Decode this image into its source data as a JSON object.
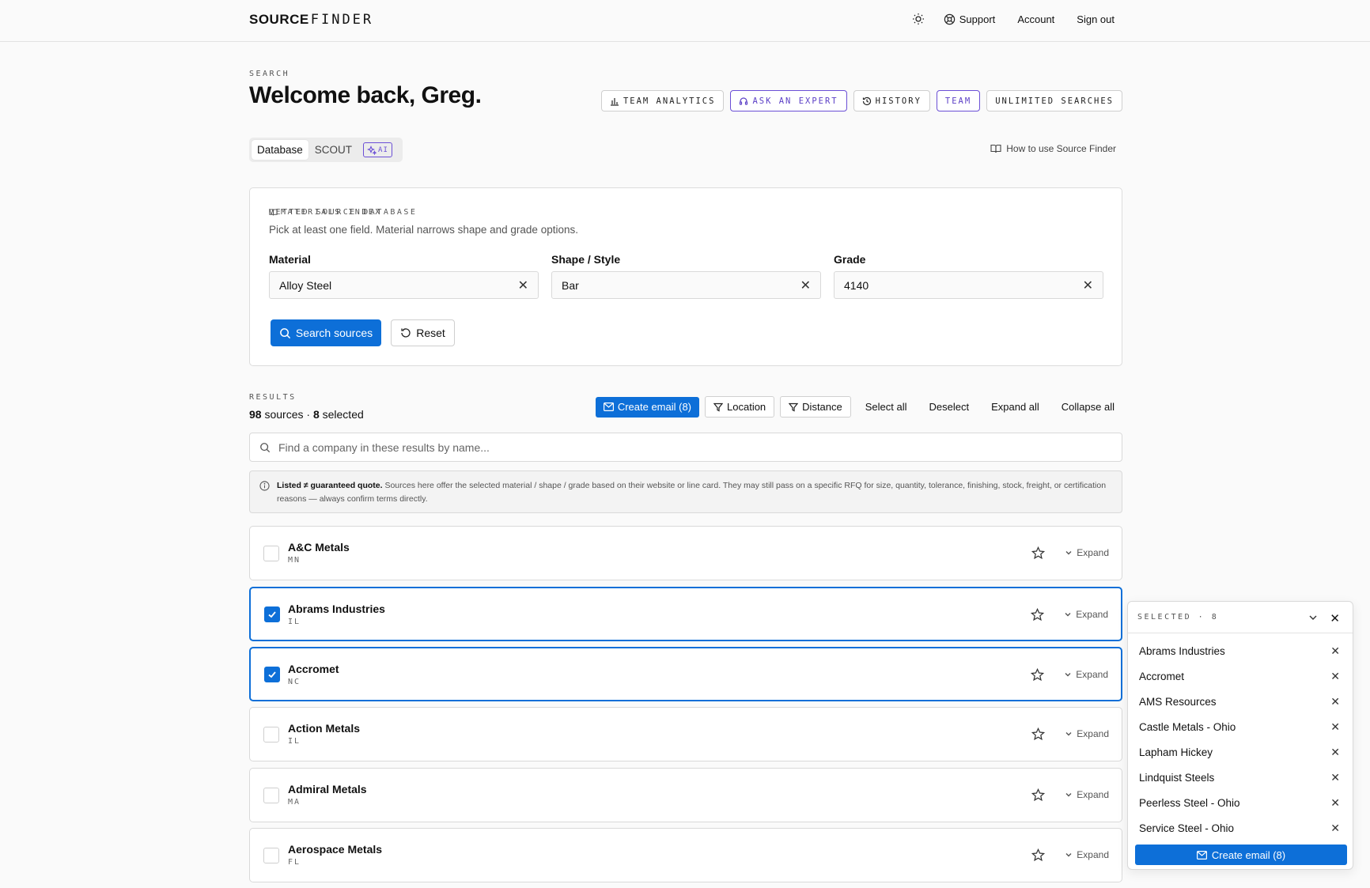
{
  "brand": {
    "part1": "SOURCE",
    "part2": "FINDER"
  },
  "topnav": {
    "support": "Support",
    "account": "Account",
    "signout": "Sign out"
  },
  "hero": {
    "eyebrow": "SEARCH",
    "welcome": "Welcome back, Greg."
  },
  "pills": {
    "team_analytics": "TEAM ANALYTICS",
    "ask_expert": "ASK AN EXPERT",
    "history": "HISTORY",
    "team": "TEAM",
    "unlimited": "UNLIMITED SEARCHES"
  },
  "modes": {
    "database": "Database",
    "scout": "SCOUT",
    "ai": "AI"
  },
  "howto": "How to use Source Finder",
  "search_card": {
    "eyebrow": "VETTED SOURCE DATABASE",
    "materials_index": "MATERIALS INDEX",
    "hint": "Pick at least one field. Material narrows shape and grade options.",
    "fields": {
      "material": {
        "label": "Material",
        "value": "Alloy Steel"
      },
      "shape": {
        "label": "Shape / Style",
        "value": "Bar"
      },
      "grade": {
        "label": "Grade",
        "value": "4140"
      }
    },
    "search_button": "Search sources",
    "reset_button": "Reset"
  },
  "results": {
    "eyebrow": "RESULTS",
    "count": "98",
    "count_suffix": "sources ·",
    "selected": "8",
    "selected_suffix": "selected",
    "create_email": "Create email (8)",
    "location": "Location",
    "distance": "Distance",
    "select_all": "Select all",
    "deselect": "Deselect",
    "expand_all": "Expand all",
    "collapse_all": "Collapse all",
    "search_placeholder": "Find a company in these results by name...",
    "notice_bold": "Listed ≠ guaranteed quote.",
    "notice_text": " Sources here offer the selected material / shape / grade based on their website or line card. They may still pass on a specific RFQ for size, quantity, tolerance, finishing, stock, freight, or certification reasons — always confirm terms directly.",
    "expand_label": "Expand",
    "rows": [
      {
        "name": "A&C Metals",
        "state": "MN",
        "selected": false
      },
      {
        "name": "Abrams Industries",
        "state": "IL",
        "selected": true
      },
      {
        "name": "Accromet",
        "state": "NC",
        "selected": true
      },
      {
        "name": "Action Metals",
        "state": "IL",
        "selected": false
      },
      {
        "name": "Admiral Metals",
        "state": "MA",
        "selected": false
      },
      {
        "name": "Aerospace Metals",
        "state": "FL",
        "selected": false
      }
    ]
  },
  "selected_panel": {
    "eyebrow": "SELECTED · 8",
    "items": [
      "Abrams Industries",
      "Accromet",
      "AMS Resources",
      "Castle Metals - Ohio",
      "Lapham Hickey",
      "Lindquist Steels",
      "Peerless Steel - Ohio",
      "Service Steel - Ohio"
    ],
    "cta": "Create email (8)"
  },
  "colors": {
    "accent": "#0d6fd8",
    "ai_purple": "#6b4fd6"
  }
}
